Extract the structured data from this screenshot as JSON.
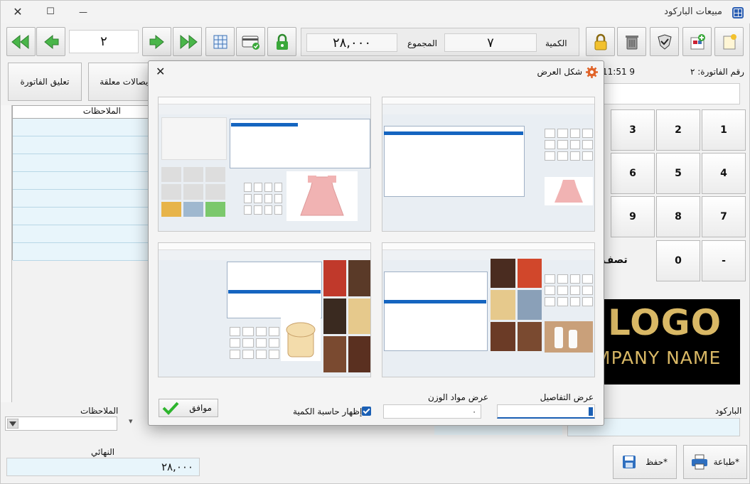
{
  "window": {
    "title": "مبيعات الباركود",
    "close_glyph": "✕",
    "max_glyph": "☐",
    "min_glyph": "—"
  },
  "toolbar": {
    "page_number": "٢",
    "total_label": "المجموع",
    "total_value": "٢٨,٠٠٠",
    "quantity_label": "الكمية",
    "quantity_value": "٧"
  },
  "invoice": {
    "number_label": "رقم الفاتورة: ٢",
    "time": "11:51 9"
  },
  "buttons": {
    "suspend_invoice": "تعليق الفاتورة",
    "suspended_receipts": "ايصالات معلقة",
    "print": "طباعة*",
    "save": "حفظ*"
  },
  "notes": {
    "grid_header": "الملاحظات",
    "field_label": "الملاحظات",
    "rows": 8
  },
  "keypad": {
    "keys": [
      "1",
      "2",
      "3",
      "4",
      "5",
      "6",
      "7",
      "8",
      "9",
      "-",
      "0"
    ],
    "partial_label": "تصف"
  },
  "logo": {
    "word": "LOGO",
    "company": "MPANY NAME"
  },
  "barcode": {
    "label": "الباركود"
  },
  "final": {
    "label": "النهائي",
    "value": "٢٨,٠٠٠"
  },
  "dialog": {
    "title": "شكل العرض",
    "close_glyph": "✕",
    "details_label": "عرض التفاصيل",
    "weight_label": "عرض مواد الوزن",
    "weight_value": "٠",
    "calc_label": "إظهار حاسبة الكمية",
    "ok_label": "موافق"
  },
  "colors": {
    "accent_blue": "#1a5fb4",
    "arrow_green": "#2e9b2e",
    "input_bg": "#e8f5fb",
    "logo_gold": "#d9b865"
  }
}
